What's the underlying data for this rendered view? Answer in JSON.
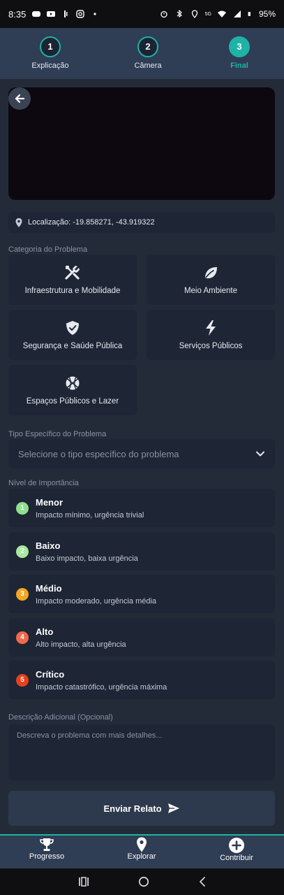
{
  "status_bar": {
    "time": "8:35",
    "battery": "95%",
    "network": "5G"
  },
  "stepper": {
    "steps": [
      {
        "number": "1",
        "label": "Explicação"
      },
      {
        "number": "2",
        "label": "Câmera"
      },
      {
        "number": "3",
        "label": "Final"
      }
    ],
    "active_step": 3,
    "accent": "#1eb3a6"
  },
  "location": {
    "text": "Localização: -19.858271, -43.919322"
  },
  "category_section": {
    "title": "Categoria do Problema",
    "items": [
      {
        "label": "Infraestrutura e Mobilidade",
        "icon": "tools-icon"
      },
      {
        "label": "Meio Ambiente",
        "icon": "leaf-icon"
      },
      {
        "label": "Segurança e Saúde Pública",
        "icon": "shield-check-icon"
      },
      {
        "label": "Serviços Públicos",
        "icon": "bolt-icon"
      },
      {
        "label": "Espaços Públicos e Lazer",
        "icon": "basketball-icon"
      }
    ]
  },
  "problem_type": {
    "title": "Tipo Específico do Problema",
    "placeholder": "Selecione o tipo específico do problema"
  },
  "importance": {
    "title": "Nível de Importância",
    "levels": [
      {
        "number": "1",
        "title": "Menor",
        "description": "Impacto mínimo, urgência trivial",
        "color": "#8ee08c"
      },
      {
        "number": "2",
        "title": "Baixo",
        "description": "Baixo impacto, baixa urgência",
        "color": "#a8e8a0"
      },
      {
        "number": "3",
        "title": "Médio",
        "description": "Impacto moderado, urgência média",
        "color": "#f5a623"
      },
      {
        "number": "4",
        "title": "Alto",
        "description": "Alto impacto, alta urgência",
        "color": "#ef6a4d"
      },
      {
        "number": "5",
        "title": "Crítico",
        "description": "Impacto catastrófico, urgência máxima",
        "color": "#e8401c"
      }
    ]
  },
  "description": {
    "title": "Descrição Adicional (Opcional)",
    "placeholder": "Descreva o problema com mais detalhes..."
  },
  "submit_label": "Enviar Relato",
  "bottom_nav": {
    "items": [
      {
        "label": "Progresso",
        "icon": "trophy-icon"
      },
      {
        "label": "Explorar",
        "icon": "map-pin-icon"
      },
      {
        "label": "Contribuir",
        "icon": "plus-circle-icon"
      }
    ]
  }
}
